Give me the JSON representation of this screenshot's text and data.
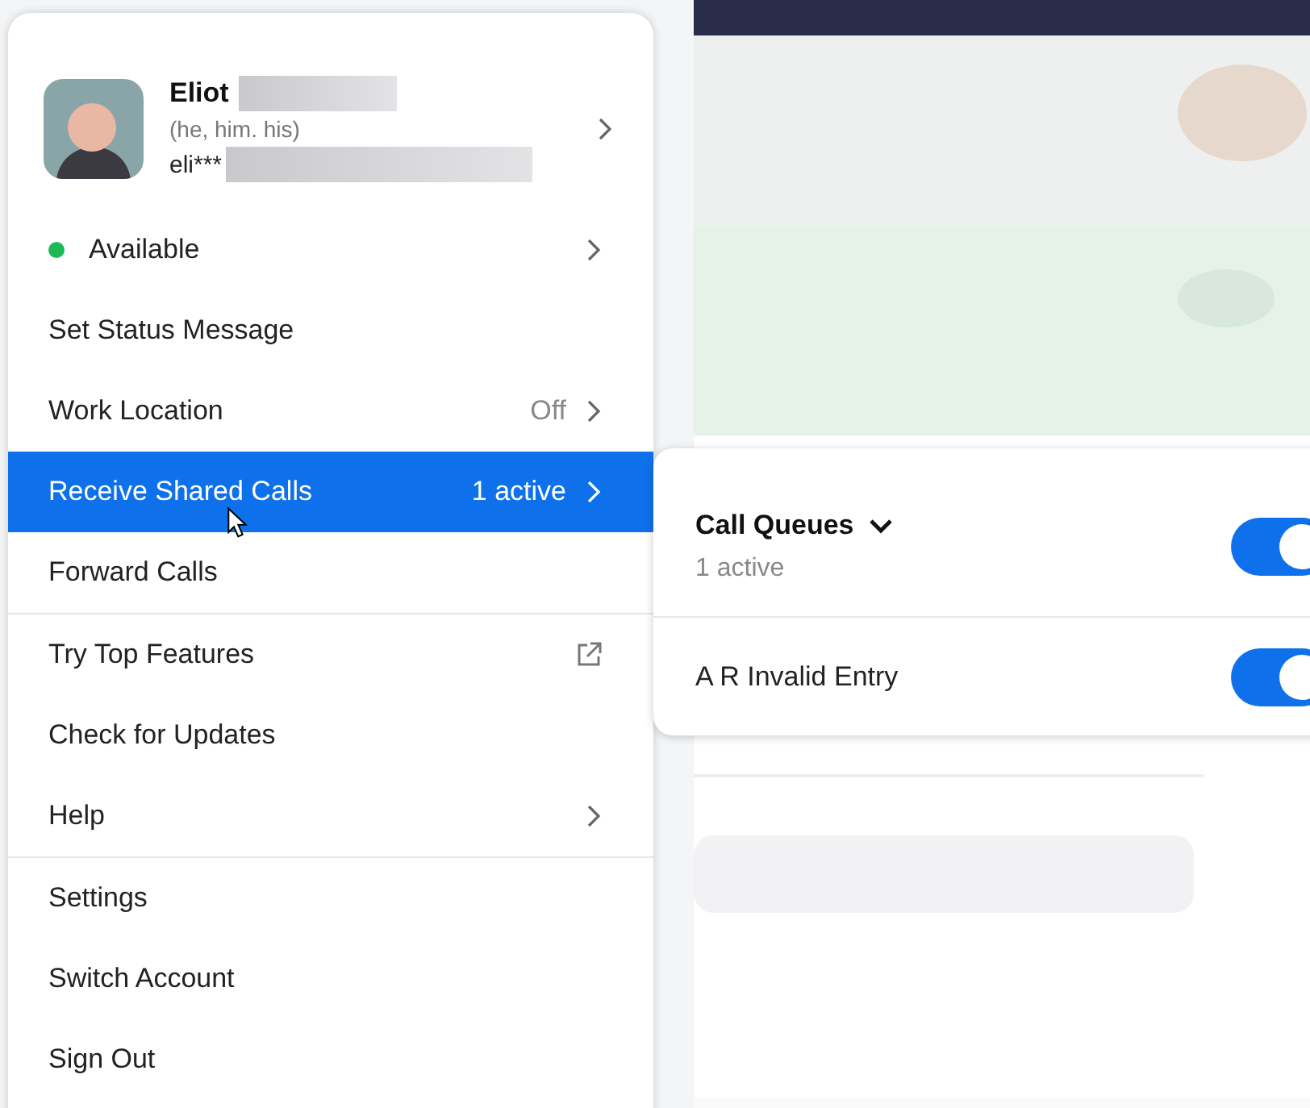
{
  "profile": {
    "name": "Eliot",
    "pronouns": "(he, him. his)",
    "email": "eli***",
    "name_redacted": true,
    "email_redacted": true
  },
  "menu_groups": [
    [
      {
        "kind": "status",
        "label": "Available",
        "color": "#1db954",
        "chevron": true,
        "selected": false
      },
      {
        "kind": "item",
        "label": "Set Status Message",
        "chevron": false,
        "selected": false
      },
      {
        "kind": "item",
        "label": "Work Location",
        "value": "Off",
        "chevron": true,
        "selected": false
      },
      {
        "kind": "item",
        "label": "Receive Shared Calls",
        "value": "1 active",
        "chevron": true,
        "selected": true
      },
      {
        "kind": "item",
        "label": "Forward Calls",
        "chevron": false,
        "selected": false
      }
    ],
    [
      {
        "kind": "external",
        "label": "Try Top Features",
        "chevron": false,
        "selected": false
      },
      {
        "kind": "item",
        "label": "Check for Updates",
        "chevron": false,
        "selected": false
      },
      {
        "kind": "item",
        "label": "Help",
        "chevron": true,
        "selected": false
      }
    ],
    [
      {
        "kind": "item",
        "label": "Settings",
        "chevron": false,
        "selected": false
      },
      {
        "kind": "item",
        "label": "Switch Account",
        "chevron": false,
        "selected": false
      },
      {
        "kind": "item",
        "label": "Sign Out",
        "chevron": false,
        "selected": false
      }
    ]
  ],
  "submenu": [
    {
      "label": "Call Queues",
      "sublabel": "1 active",
      "dropdown": true,
      "on": true
    },
    {
      "label": "A R Invalid Entry",
      "dropdown": false,
      "on": true
    }
  ]
}
